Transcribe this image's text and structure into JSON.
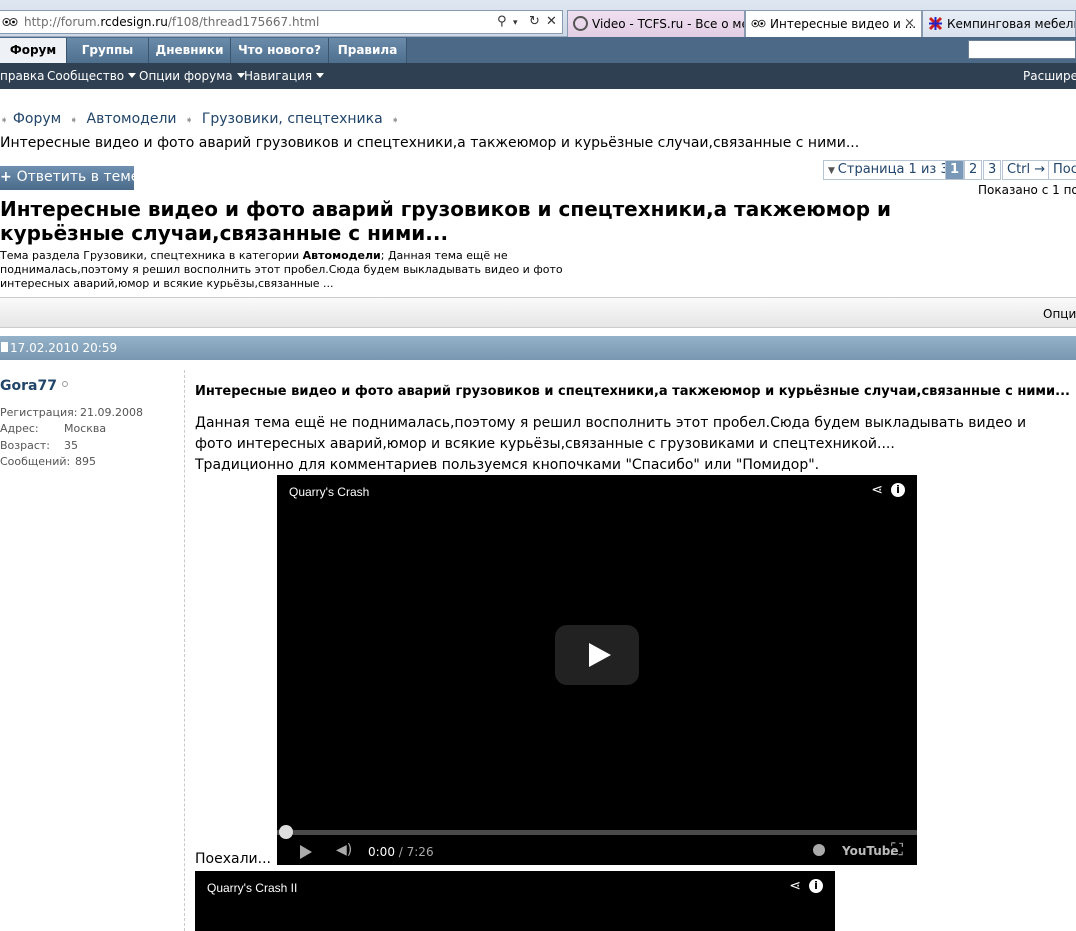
{
  "browser": {
    "url_prefix": "http://forum.",
    "url_host": "rcdesign.ru",
    "url_path": "/f108/thread175667.html",
    "tabs": [
      {
        "label": "Video - TCFS.ru - Все о ме..."
      },
      {
        "label": "Интересные видео и ..."
      },
      {
        "label": "Кемпинговая мебель"
      }
    ],
    "close_glyph": "×"
  },
  "navbar": {
    "tabs": [
      "Форум",
      "Группы",
      "Дневники",
      "Что нового?",
      "Правила"
    ]
  },
  "subnav": {
    "items": [
      "правка",
      "Сообщество",
      "Опции форума",
      "Навигация"
    ],
    "right": "Расширен"
  },
  "breadcrumb": {
    "items": [
      "Форум",
      "Автомодели",
      "Грузовики, спецтехника"
    ],
    "current": "Интересные видео и фото аварий грузовиков и спецтехники,а такжеюмор и курьёзные случаи,связанные с ними..."
  },
  "actions": {
    "reply": "Ответить в теме"
  },
  "pagination": {
    "label": "Страница 1 из 3",
    "pages": [
      "1",
      "2",
      "3"
    ],
    "ctrl": "Ctrl →",
    "last": "Посл",
    "shown": "Показано с 1 по"
  },
  "thread": {
    "title": "Интересные видео и фото аварий грузовиков и спецтехники,а такжеюмор и курьёзные случаи,связанные с ними...",
    "desc_prefix": "Тема раздела Грузовики, спецтехника в категории ",
    "desc_category": "Автомодели",
    "desc_rest": "; Данная тема ещё не поднималась,поэтому я решил восполнить этот пробел.Сюда будем выкладывать видео и фото интересных аварий,юмор и всякие курьёзы,связанные ...",
    "options": "Опции"
  },
  "post": {
    "date": "17.02.2010 20:59",
    "user": {
      "name": "Gora77",
      "fields": [
        {
          "label": "Регистрация:",
          "value": "21.09.2008"
        },
        {
          "label": "Адрес:",
          "value": "Москва"
        },
        {
          "label": "Возраст:",
          "value": "35"
        },
        {
          "label": "Сообщений:",
          "value": "895"
        }
      ]
    },
    "title": "Интересные видео и фото аварий грузовиков и спецтехники,а такжеюмор и курьёзные случаи,связанные с ними...",
    "text1": "Данная тема ещё не поднималась,поэтому я решил восполнить этот пробел.Сюда будем выкладывать видео и фото интересных аварий,юмор и всякие курьёзы,связанные с грузовиками и спецтехникой....",
    "text2": "Традиционно для комментариев пользуемся кнопочками \"Спасибо\" или \"Помидор\".",
    "go": "Поехали..."
  },
  "videos": [
    {
      "title": "Quarry's Crash",
      "time_current": "0:00",
      "time_total": " / 7:26",
      "logo": "YouTube"
    },
    {
      "title": "Quarry's Crash II"
    }
  ]
}
